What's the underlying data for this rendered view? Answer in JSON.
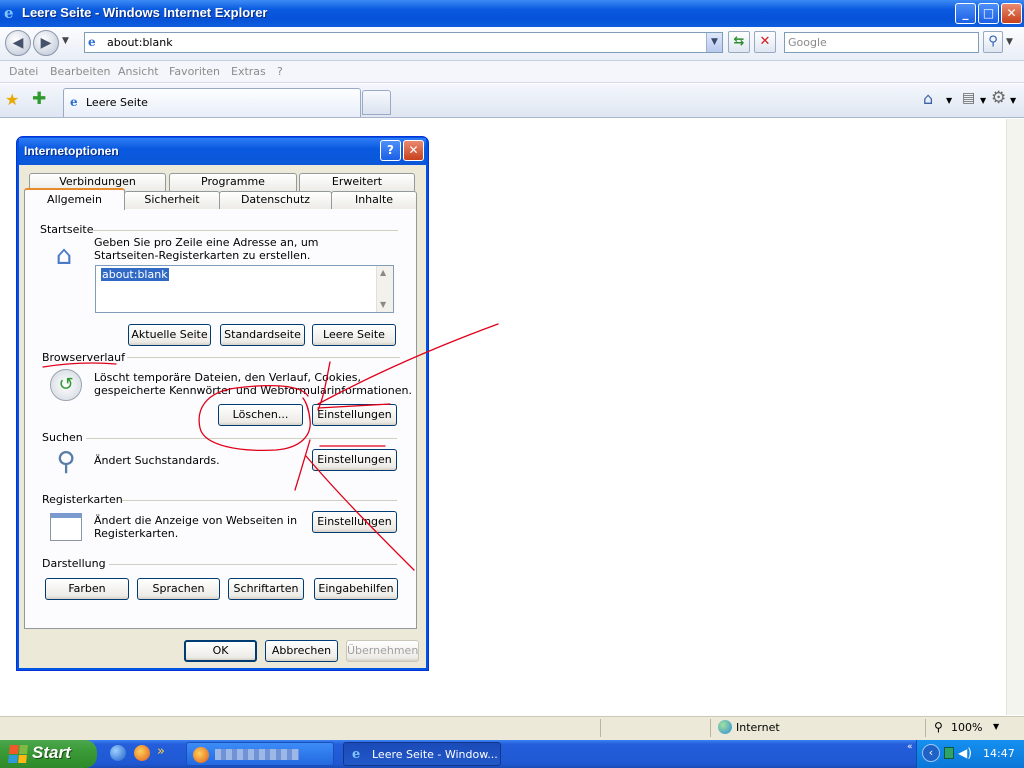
{
  "window": {
    "title": "Leere Seite - Windows Internet Explorer"
  },
  "caption_buttons": {
    "minimize": "_",
    "maximize": "□",
    "close": "✕"
  },
  "address": {
    "value": "about:blank"
  },
  "search": {
    "placeholder": "Google"
  },
  "menu": [
    "Datei",
    "Bearbeiten",
    "Ansicht",
    "Favoriten",
    "Extras",
    "?"
  ],
  "tab": {
    "label": "Leere Seite"
  },
  "status": {
    "zone": "Internet",
    "zoom": "100%"
  },
  "taskbar": {
    "start": "Start",
    "task": "Leere Seite - Window...",
    "clock": "14:47"
  },
  "dialog": {
    "title": "Internetoptionen",
    "help": "?",
    "close": "✕",
    "tabs_back": [
      "Verbindungen",
      "Programme",
      "Erweitert"
    ],
    "tabs_front": [
      "Allgemein",
      "Sicherheit",
      "Datenschutz",
      "Inhalte"
    ],
    "startseite": {
      "heading": "Startseite",
      "desc_line1": "Geben Sie pro Zeile eine Adresse an, um",
      "desc_line2": "Startseiten-Registerkarten zu erstellen.",
      "value": "about:blank",
      "btn_current": "Aktuelle Seite",
      "btn_default": "Standardseite",
      "btn_blank": "Leere Seite"
    },
    "browserverlauf": {
      "heading": "Browserverlauf",
      "desc_line1": "Löscht temporäre Dateien, den Verlauf, Cookies,",
      "desc_line2": "gespeicherte Kennwörter und Webformularinformationen.",
      "btn_delete": "Löschen...",
      "btn_settings": "Einstellungen"
    },
    "suchen": {
      "heading": "Suchen",
      "desc": "Ändert Suchstandards.",
      "btn_settings": "Einstellungen"
    },
    "registerkarten": {
      "heading": "Registerkarten",
      "desc_line1": "Ändert die Anzeige von Webseiten in",
      "desc_line2": "Registerkarten.",
      "btn_settings": "Einstellungen"
    },
    "darstellung": {
      "heading": "Darstellung",
      "btn_colors": "Farben",
      "btn_languages": "Sprachen",
      "btn_fonts": "Schriftarten",
      "btn_access": "Eingabehilfen"
    },
    "footer": {
      "ok": "OK",
      "cancel": "Abbrechen",
      "apply": "Übernehmen"
    }
  },
  "colors": {
    "annotation": "#e0001a",
    "xp_blue": "#0054e3"
  }
}
